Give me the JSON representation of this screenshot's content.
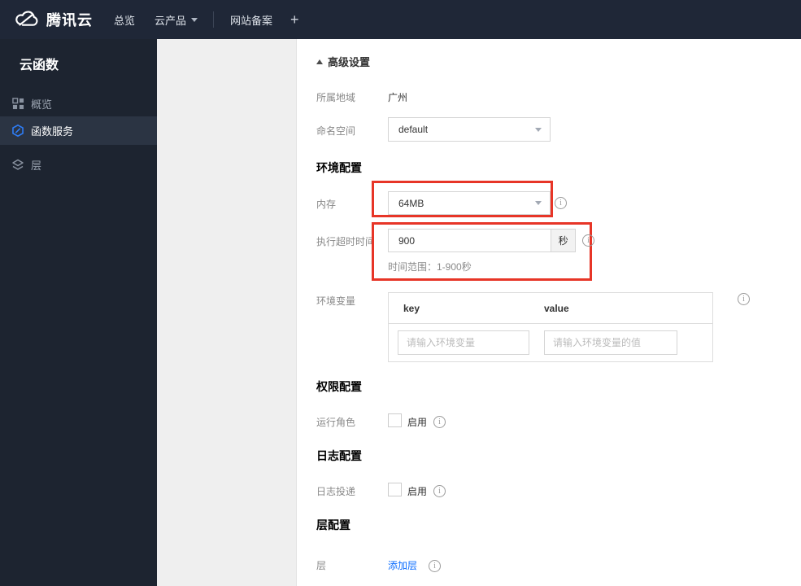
{
  "topbar": {
    "brand": "腾讯云",
    "nav": [
      {
        "label": "总览"
      },
      {
        "label": "云产品"
      },
      {
        "label": "网站备案"
      }
    ],
    "add_label": "+"
  },
  "sidebar": {
    "title": "云函数",
    "items": [
      {
        "label": "概览",
        "icon": "grid-icon",
        "active": false
      },
      {
        "label": "函数服务",
        "icon": "function-hexagon-icon",
        "active": true
      },
      {
        "label": "层",
        "icon": "layers-icon",
        "active": false
      }
    ]
  },
  "main": {
    "advanced_settings_label": "高级设置",
    "region": {
      "label": "所属地域",
      "value": "广州"
    },
    "namespace": {
      "label": "命名空间",
      "value": "default"
    },
    "sections": {
      "environment": "环境配置",
      "permission": "权限配置",
      "logging": "日志配置",
      "layers": "层配置"
    },
    "memory": {
      "label": "内存",
      "value": "64MB"
    },
    "timeout": {
      "label": "执行超时时间",
      "value": "900",
      "unit": "秒",
      "hint": "时间范围：1-900秒"
    },
    "env_vars": {
      "label": "环境变量",
      "columns": [
        "key",
        "value"
      ],
      "key_placeholder": "请输入环境变量",
      "value_placeholder": "请输入环境变量的值"
    },
    "run_role": {
      "label": "运行角色",
      "toggle_label": "启用",
      "checked": false
    },
    "log_delivery": {
      "label": "日志投递",
      "toggle_label": "启用",
      "checked": false
    },
    "layer": {
      "label": "层",
      "add_link_label": "添加层"
    }
  },
  "colors": {
    "topbar_bg": "#1f2737",
    "sidebar_bg": "#1d2430",
    "sidebar_active_bg": "#2b3443",
    "annotation_red": "#e73527",
    "link_blue": "#0a6cff",
    "function_icon_blue": "#2e7cf5"
  }
}
